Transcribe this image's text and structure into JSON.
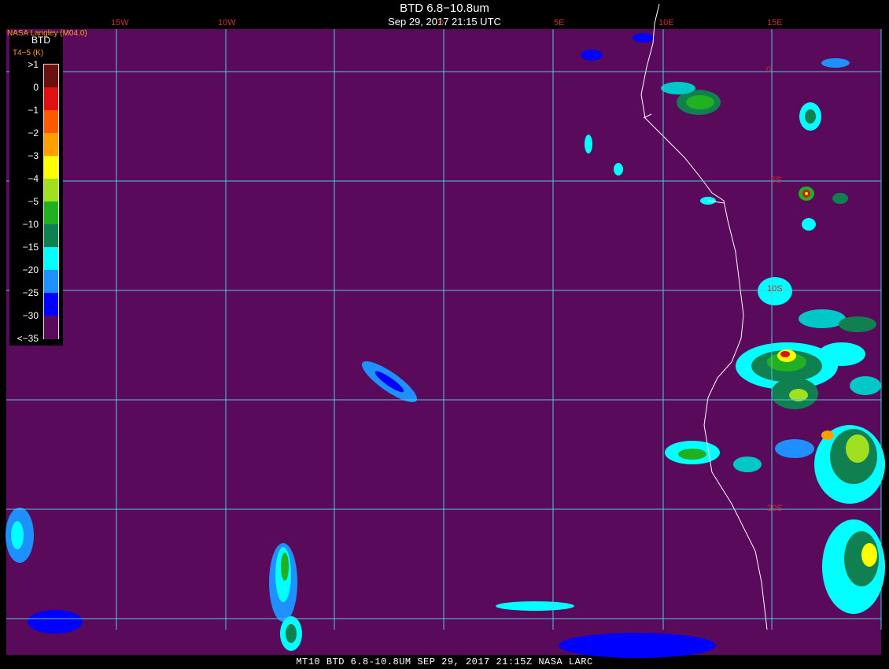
{
  "header": {
    "title": "BTD 6.8−10.8um",
    "subtitle": "Sep 29, 2017 21:15 UTC",
    "source": "NASA Langley (M04.0)"
  },
  "legend": {
    "title": "BTD",
    "subtitle": "T4−5 (K)",
    "labels": [
      ">1",
      "0",
      "−1",
      "−2",
      "−3",
      "−4",
      "−5",
      "−10",
      "−15",
      "−20",
      "−25",
      "−30",
      "<−35"
    ],
    "colors": [
      "#6a1010",
      "#e01010",
      "#ff5a00",
      "#ffa000",
      "#ffff00",
      "#a0e020",
      "#20b020",
      "#108050",
      "#00ffff",
      "#1e90ff",
      "#0000ff",
      "#5a0a5a"
    ]
  },
  "map": {
    "background": "#5a0a5a",
    "grid_color": "#50c8e0",
    "coast_color": "#ffffff",
    "lon_labels": [
      "15W",
      "10W",
      "0",
      "5E",
      "10E",
      "15E"
    ],
    "lat_labels": [
      "0",
      "5S",
      "10S",
      "20S"
    ]
  },
  "footer": "MT10  BTD 6.8-10.8UM  SEP 29, 2017 21:15Z  NASA LARC"
}
